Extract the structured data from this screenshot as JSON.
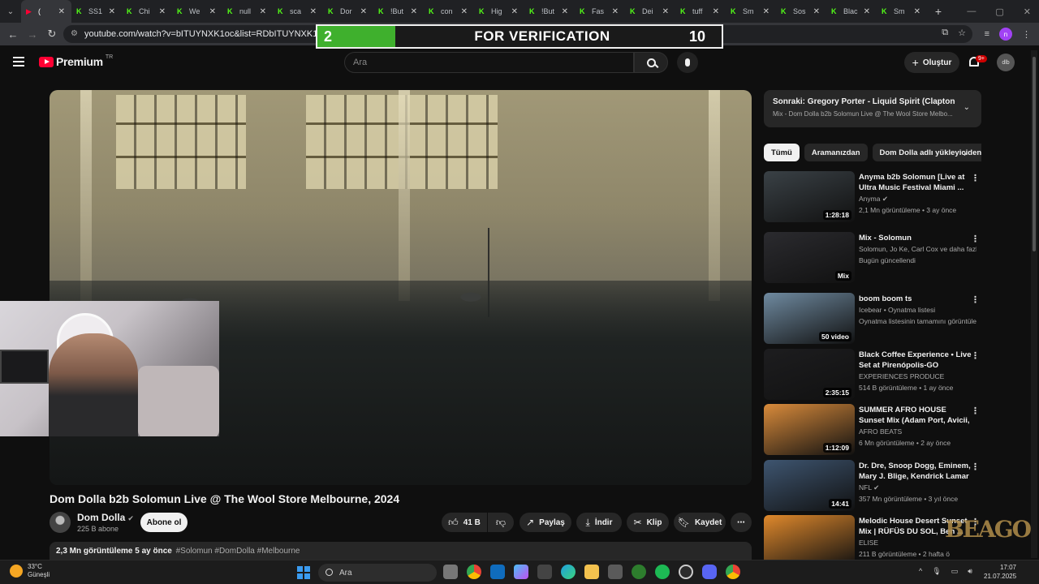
{
  "browser": {
    "tabs": [
      {
        "label": "(",
        "fav": "yt"
      },
      {
        "label": "SS1",
        "fav": "K"
      },
      {
        "label": "Chi",
        "fav": "K"
      },
      {
        "label": "We",
        "fav": "K"
      },
      {
        "label": "null",
        "fav": "K"
      },
      {
        "label": "sca",
        "fav": "K"
      },
      {
        "label": "Dor",
        "fav": "K"
      },
      {
        "label": "!But",
        "fav": "K"
      },
      {
        "label": "con",
        "fav": "K"
      },
      {
        "label": "Hig",
        "fav": "K"
      },
      {
        "label": "!But",
        "fav": "K"
      },
      {
        "label": "Fas",
        "fav": "K"
      },
      {
        "label": "Dei",
        "fav": "K"
      },
      {
        "label": "tuff",
        "fav": "K"
      },
      {
        "label": "Sm",
        "fav": "K"
      },
      {
        "label": "Sos",
        "fav": "K"
      },
      {
        "label": "Blac",
        "fav": "K"
      },
      {
        "label": "Sm",
        "fav": "K"
      }
    ],
    "url": "youtube.com/watch?v=bITUYNXK1oc&list=RDbITUYNXK1oc&start_r",
    "profile_initial": "n"
  },
  "verification": {
    "left_value": "2",
    "title": "FOR VERIFICATION",
    "right_value": "10"
  },
  "youtube": {
    "logo_text": "Premium",
    "country_code": "TR",
    "search_placeholder": "Ara",
    "create_label": "Oluştur",
    "notif_count": "9+",
    "avatar_text": "dlb"
  },
  "video": {
    "title": "Dom Dolla b2b Solomun Live @ The Wool Store Melbourne, 2024",
    "channel": "Dom Dolla",
    "subscribers": "225 B abone",
    "subscribe_label": "Abone ol",
    "likes": "41 B",
    "share_label": "Paylaş",
    "download_label": "İndir",
    "clip_label": "Klip",
    "save_label": "Kaydet",
    "views_date": "2,3 Mn görüntüleme  5 ay önce",
    "tags": "#Solomun #DomDolla #Melbourne"
  },
  "up_next": {
    "title": "Sonraki: Gregory Porter - Liquid Spirit (Claptone Re...",
    "subtitle": "Mix - Dom Dolla b2b Solomun Live @ The Wool Store Melbo..."
  },
  "chips": [
    "Tümü",
    "Aramanızdan",
    "Dom Dolla adlı yükleyiciden"
  ],
  "recommendations": [
    {
      "title": "Anyma b2b Solomun [Live at Ultra Music Festival Miami ...",
      "channel": "Anyma ✔",
      "meta": "2,1 Mn görüntüleme • 3 ay önce",
      "duration": "1:28:18",
      "thumb": "#3a4146"
    },
    {
      "title": "Mix - Solomun",
      "channel": "Solomun, Jo Ke, Carl Cox ve daha fazlası",
      "meta": "Bugün güncellendi",
      "duration": "Mix",
      "thumb": "#2b2b2f"
    },
    {
      "title": "boom boom ts",
      "channel": "Icebear • Oynatma listesi",
      "meta": "Oynatma listesinin tamamını görüntüle",
      "duration": "50 video",
      "thumb": "#6f8aa0"
    },
    {
      "title": "Black Coffee Experience • Live Set at Pirenópolis-GO",
      "channel": "EXPERIENCES PRODUCE",
      "meta": "514 B görüntüleme • 1 ay önce",
      "duration": "2:35:15",
      "thumb": "#1d1d1f"
    },
    {
      "title": "SUMMER AFRO HOUSE Sunset Mix (Adam Port, Avicii, The ...",
      "channel": "AFRO BEATS",
      "meta": "6 Mn görüntüleme • 2 ay önce",
      "duration": "1:12:09",
      "thumb": "#d98b3b"
    },
    {
      "title": "Dr. Dre, Snoop Dogg, Eminem, Mary J. Blige, Kendrick Lamar ...",
      "channel": "NFL ✔",
      "meta": "357 Mn görüntüleme • 3 yıl önce",
      "duration": "14:41",
      "thumb": "#3e5570"
    },
    {
      "title": "Melodic House Desert Sunset Mix | RÜFÜS DU SOL, Ben ...",
      "channel": "ELISE",
      "meta": "211 B görüntüleme • 2 hafta ö",
      "duration": "",
      "thumb": "#e0892c"
    }
  ],
  "taskbar": {
    "temperature": "33°C",
    "weather": "Güneşli",
    "search_label": "Ara",
    "time": "17:07",
    "date": "21.07.2025"
  },
  "colors": {
    "youtube_red": "#ff0033",
    "kick_green": "#53fc18",
    "verify_green": "#3fb02d"
  }
}
